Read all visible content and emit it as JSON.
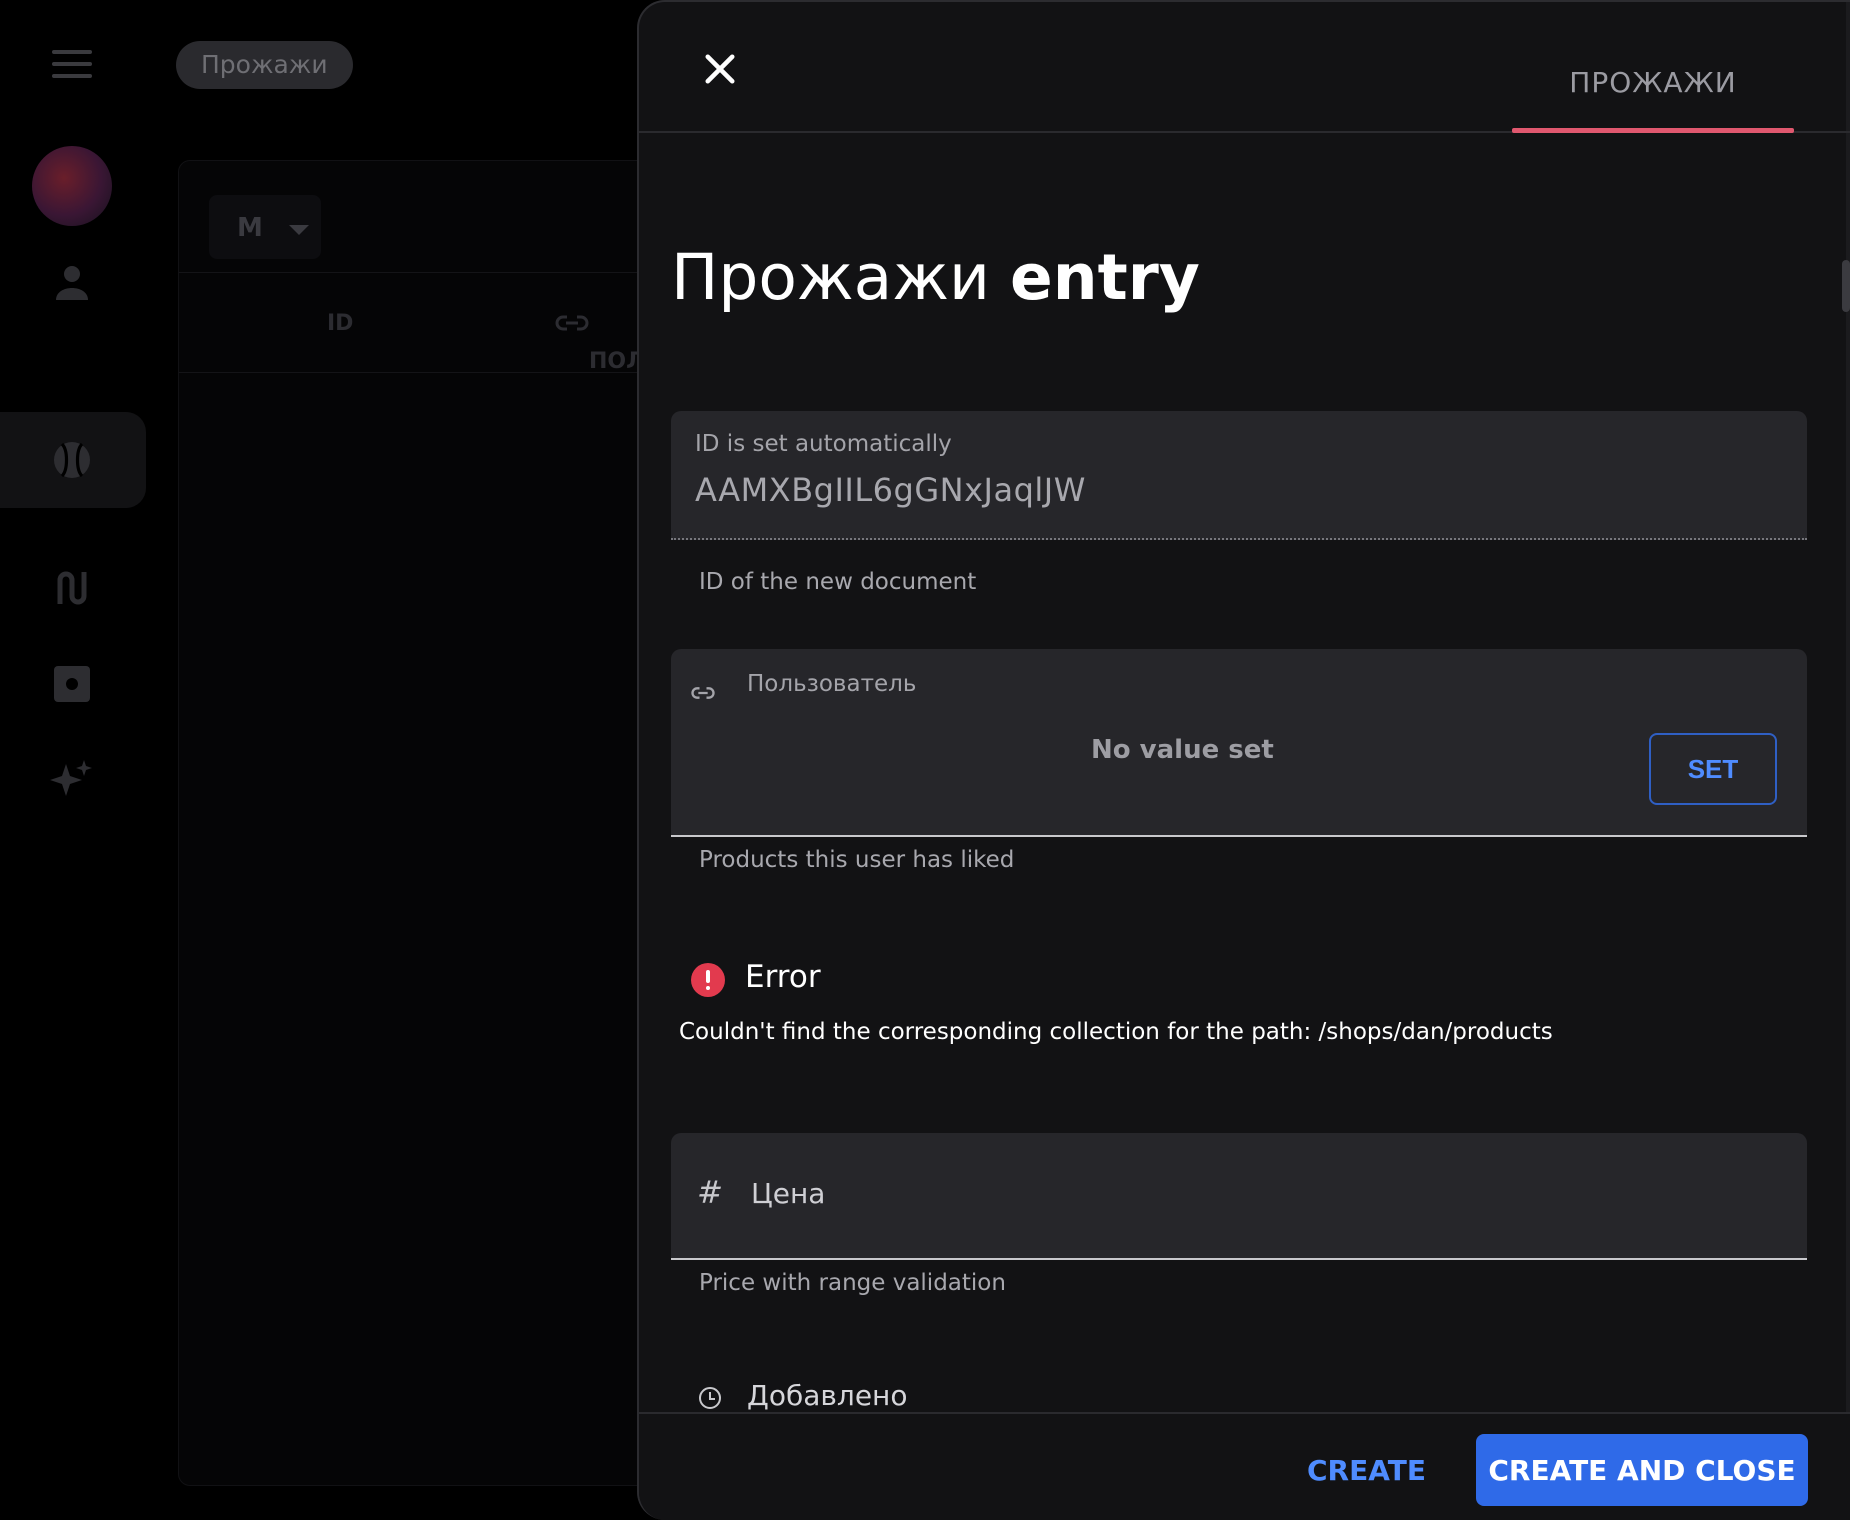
{
  "background": {
    "breadcrumb": "Прожажи",
    "select_value": "M",
    "columns": [
      "ID",
      "ПОЛЬ"
    ]
  },
  "drawer": {
    "tab_label": "ПРОЖАЖИ",
    "title_collection": "Прожажи",
    "title_suffix": "entry",
    "id_field": {
      "label": "ID is set automatically",
      "value": "AAMXBgIIL6gGNxJaqlJW",
      "helper": "ID of the new document"
    },
    "reference_field": {
      "label": "Пользователь",
      "empty_text": "No value set",
      "set_label": "SET",
      "helper": "Products this user has liked"
    },
    "error": {
      "title": "Error",
      "message": "Couldn't find the corresponding collection for the path: /shops/dan/products"
    },
    "price_field": {
      "label": "Цена",
      "helper": "Price with range validation"
    },
    "date_field": {
      "label": "Добавлено"
    },
    "footer": {
      "create_label": "CREATE",
      "create_close_label": "CREATE AND CLOSE"
    }
  },
  "colors": {
    "accent_blue": "#2f6ae8",
    "tab_underline": "#e0586f",
    "error_red": "#e23a4e"
  },
  "icons": [
    "menu-icon",
    "user-icon",
    "ball-icon",
    "route-icon",
    "settings-icon",
    "sparkle-icon",
    "close-icon",
    "link-icon",
    "error-icon",
    "hash-icon",
    "clock-icon"
  ]
}
